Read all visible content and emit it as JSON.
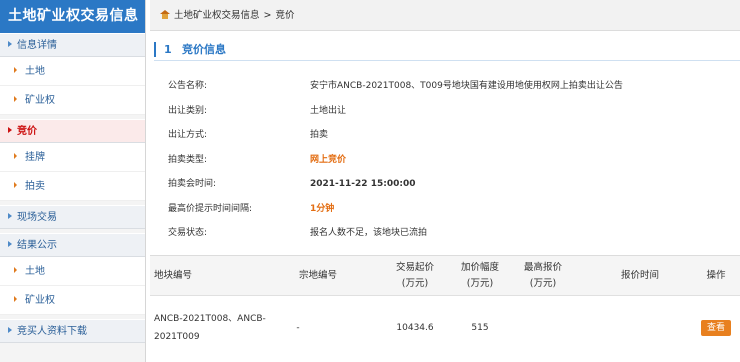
{
  "sidebar": {
    "title": "土地矿业权交易信息",
    "sections": [
      {
        "label": "信息详情",
        "items": [
          "土地",
          "矿业权"
        ]
      },
      {
        "label": "竞价",
        "items": [
          "挂牌",
          "拍卖"
        ]
      },
      {
        "label": "现场交易",
        "items": []
      },
      {
        "label": "结果公示",
        "items": [
          "土地",
          "矿业权"
        ]
      },
      {
        "label": "竞买人资料下载",
        "items": []
      }
    ]
  },
  "breadcrumb": {
    "root": "土地矿业权交易信息",
    "separator": ">",
    "current": "竞价"
  },
  "panel": {
    "number": "1",
    "title": "竞价信息"
  },
  "info": [
    {
      "label": "公告名称:",
      "value": "安宁市ANCB-2021T008、T009号地块国有建设用地使用权网上拍卖出让公告"
    },
    {
      "label": "出让类别:",
      "value": "土地出让"
    },
    {
      "label": "出让方式:",
      "value": "拍卖"
    },
    {
      "label": "拍卖类型:",
      "value": "网上竞价"
    },
    {
      "label": "拍卖会时间:",
      "value": "2021-11-22 15:00:00"
    },
    {
      "label": "最高价提示时间间隔:",
      "value": "1分钟"
    },
    {
      "label": "交易状态:",
      "value": "报名人数不足，该地块已流拍"
    }
  ],
  "table": {
    "headers": {
      "parcel_no": "地块编号",
      "lot_no": "宗地编号",
      "start_price": "交易起价\n(万元)",
      "increment": "加价幅度\n(万元)",
      "max_bid": "最高报价\n(万元)",
      "bid_time": "报价时间",
      "action": "操作"
    },
    "rows": [
      {
        "parcel_no": "ANCB-2021T008、ANCB-2021T009",
        "lot_no": "-",
        "start_price": "10434.6",
        "increment": "515",
        "max_bid": "",
        "bid_time": "",
        "action": "查看"
      }
    ]
  },
  "colors": {
    "brand_blue": "#2b78c5",
    "accent_orange": "#e36d12",
    "active_red": "#cc1111"
  }
}
